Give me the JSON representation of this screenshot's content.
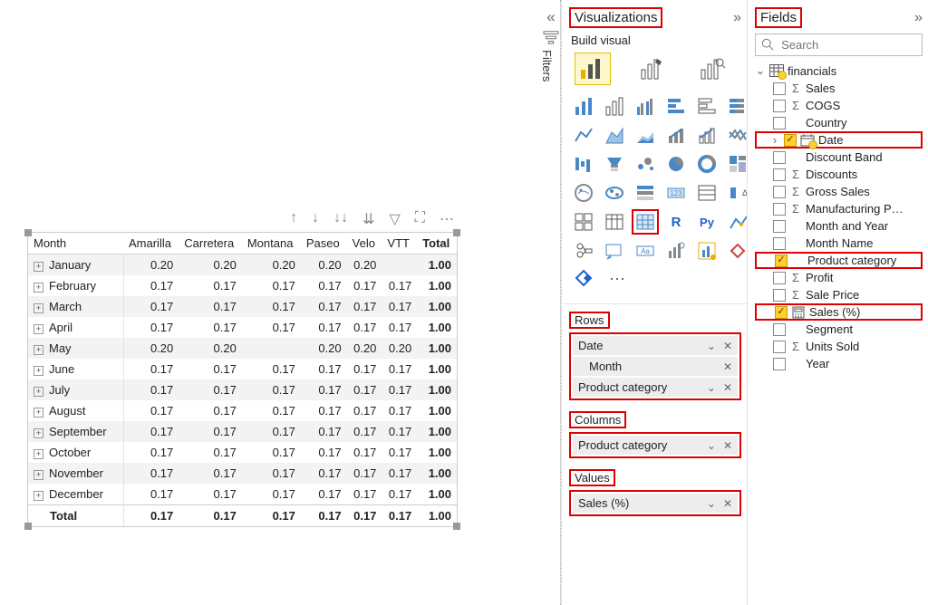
{
  "filters_pane_label": "Filters",
  "matrix": {
    "columns": [
      "Month",
      "Amarilla",
      "Carretera",
      "Montana",
      "Paseo",
      "Velo",
      "VTT",
      "Total"
    ],
    "rows": [
      {
        "m": "January",
        "v": [
          "0.20",
          "0.20",
          "0.20",
          "0.20",
          "0.20",
          "",
          "1.00"
        ]
      },
      {
        "m": "February",
        "v": [
          "0.17",
          "0.17",
          "0.17",
          "0.17",
          "0.17",
          "0.17",
          "1.00"
        ]
      },
      {
        "m": "March",
        "v": [
          "0.17",
          "0.17",
          "0.17",
          "0.17",
          "0.17",
          "0.17",
          "1.00"
        ]
      },
      {
        "m": "April",
        "v": [
          "0.17",
          "0.17",
          "0.17",
          "0.17",
          "0.17",
          "0.17",
          "1.00"
        ]
      },
      {
        "m": "May",
        "v": [
          "0.20",
          "0.20",
          "",
          "0.20",
          "0.20",
          "0.20",
          "1.00"
        ]
      },
      {
        "m": "June",
        "v": [
          "0.17",
          "0.17",
          "0.17",
          "0.17",
          "0.17",
          "0.17",
          "1.00"
        ]
      },
      {
        "m": "July",
        "v": [
          "0.17",
          "0.17",
          "0.17",
          "0.17",
          "0.17",
          "0.17",
          "1.00"
        ]
      },
      {
        "m": "August",
        "v": [
          "0.17",
          "0.17",
          "0.17",
          "0.17",
          "0.17",
          "0.17",
          "1.00"
        ]
      },
      {
        "m": "September",
        "v": [
          "0.17",
          "0.17",
          "0.17",
          "0.17",
          "0.17",
          "0.17",
          "1.00"
        ]
      },
      {
        "m": "October",
        "v": [
          "0.17",
          "0.17",
          "0.17",
          "0.17",
          "0.17",
          "0.17",
          "1.00"
        ]
      },
      {
        "m": "November",
        "v": [
          "0.17",
          "0.17",
          "0.17",
          "0.17",
          "0.17",
          "0.17",
          "1.00"
        ]
      },
      {
        "m": "December",
        "v": [
          "0.17",
          "0.17",
          "0.17",
          "0.17",
          "0.17",
          "0.17",
          "1.00"
        ]
      }
    ],
    "total_row": {
      "label": "Total",
      "v": [
        "0.17",
        "0.17",
        "0.17",
        "0.17",
        "0.17",
        "0.17",
        "1.00"
      ]
    }
  },
  "visualizations": {
    "title": "Visualizations",
    "build_label": "Build visual",
    "wells": {
      "rows": {
        "title": "Rows",
        "items": [
          {
            "label": "Date",
            "chevron": true
          },
          {
            "label": "Month",
            "chevron": false,
            "indent": true
          },
          {
            "label": "Product category",
            "chevron": true
          }
        ]
      },
      "columns": {
        "title": "Columns",
        "items": [
          {
            "label": "Product category",
            "chevron": true
          }
        ]
      },
      "values": {
        "title": "Values",
        "items": [
          {
            "label": "Sales (%)",
            "chevron": true
          }
        ]
      }
    }
  },
  "fields": {
    "title": "Fields",
    "search_placeholder": "Search",
    "table_name": "financials",
    "items": [
      {
        "label": "Sales",
        "checked": false,
        "sigma": true,
        "hl": false
      },
      {
        "label": "COGS",
        "checked": false,
        "sigma": true,
        "hl": false
      },
      {
        "label": "Country",
        "checked": false,
        "sigma": false,
        "hl": false
      },
      {
        "label": "Date",
        "checked": true,
        "sigma": false,
        "hl": true,
        "icon": "date",
        "expand": true
      },
      {
        "label": "Discount Band",
        "checked": false,
        "sigma": false,
        "hl": false
      },
      {
        "label": "Discounts",
        "checked": false,
        "sigma": true,
        "hl": false
      },
      {
        "label": "Gross Sales",
        "checked": false,
        "sigma": true,
        "hl": false
      },
      {
        "label": "Manufacturing P…",
        "checked": false,
        "sigma": true,
        "hl": false
      },
      {
        "label": "Month and Year",
        "checked": false,
        "sigma": false,
        "hl": false
      },
      {
        "label": "Month Name",
        "checked": false,
        "sigma": false,
        "hl": false
      },
      {
        "label": "Product category",
        "checked": true,
        "sigma": false,
        "hl": true
      },
      {
        "label": "Profit",
        "checked": false,
        "sigma": true,
        "hl": false
      },
      {
        "label": "Sale Price",
        "checked": false,
        "sigma": true,
        "hl": false
      },
      {
        "label": "Sales (%)",
        "checked": true,
        "sigma": false,
        "hl": true,
        "icon": "measure"
      },
      {
        "label": "Segment",
        "checked": false,
        "sigma": false,
        "hl": false
      },
      {
        "label": "Units Sold",
        "checked": false,
        "sigma": true,
        "hl": false
      },
      {
        "label": "Year",
        "checked": false,
        "sigma": false,
        "hl": false
      }
    ]
  }
}
